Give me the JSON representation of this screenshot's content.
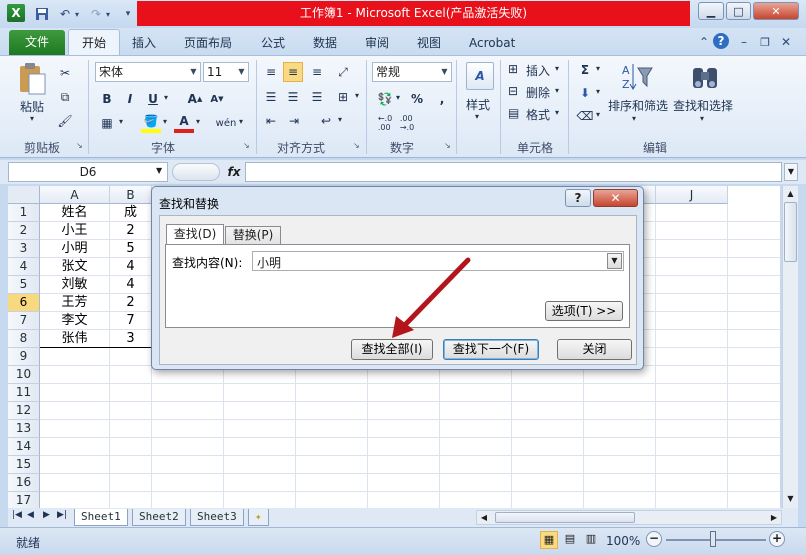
{
  "window": {
    "title": "工作簿1 - Microsoft Excel(产品激活失败)",
    "app_icon": "X"
  },
  "ribbon_tabs": [
    "文件",
    "开始",
    "插入",
    "页面布局",
    "公式",
    "数据",
    "审阅",
    "视图",
    "Acrobat"
  ],
  "clipboard": {
    "paste": "粘贴",
    "label": "剪贴板"
  },
  "font": {
    "name": "宋体",
    "size": "11",
    "label": "字体"
  },
  "alignment": {
    "label": "对齐方式"
  },
  "number": {
    "format": "常规",
    "percent": "%",
    "comma": ",",
    "label": "数字"
  },
  "styles": {
    "label": "样式"
  },
  "cells_group": {
    "insert": "插入",
    "delete": "删除",
    "format": "格式",
    "label": "单元格"
  },
  "editing": {
    "sigma": "Σ",
    "sort": "排序和筛选",
    "find": "查找和选择",
    "label": "编辑"
  },
  "formula_bar": {
    "cell": "D6",
    "fx": "fx"
  },
  "columns": [
    "A",
    "B",
    "C",
    "D",
    "E",
    "F",
    "G",
    "H",
    "I",
    "J"
  ],
  "rows": [
    "1",
    "2",
    "3",
    "4",
    "5",
    "6",
    "7",
    "8",
    "9",
    "10",
    "11",
    "12",
    "13",
    "14",
    "15",
    "16",
    "17"
  ],
  "selected_row": "6",
  "cells": {
    "A": [
      "姓名",
      "小王",
      "小明",
      "张文",
      "刘敏",
      "王芳",
      "李文",
      "张伟"
    ],
    "B": [
      "成",
      "2",
      "5",
      "4",
      "4",
      "2",
      "7",
      "3"
    ]
  },
  "dialog": {
    "title": "查找和替换",
    "help": "?",
    "close": "✕",
    "tabs": [
      "查找(D)",
      "替换(P)"
    ],
    "find_label": "查找内容(N):",
    "find_value": "小明",
    "options": "选项(T) >>",
    "find_all": "查找全部(I)",
    "find_next": "查找下一个(F)",
    "close_btn": "关闭"
  },
  "sheets": [
    "Sheet1",
    "Sheet2",
    "Sheet3"
  ],
  "status": {
    "ready": "就绪",
    "zoom": "100%"
  },
  "colors": {
    "file_tab": "#2a8a2e",
    "title_highlight": "#e8101a",
    "arrow": "#b3151b"
  }
}
